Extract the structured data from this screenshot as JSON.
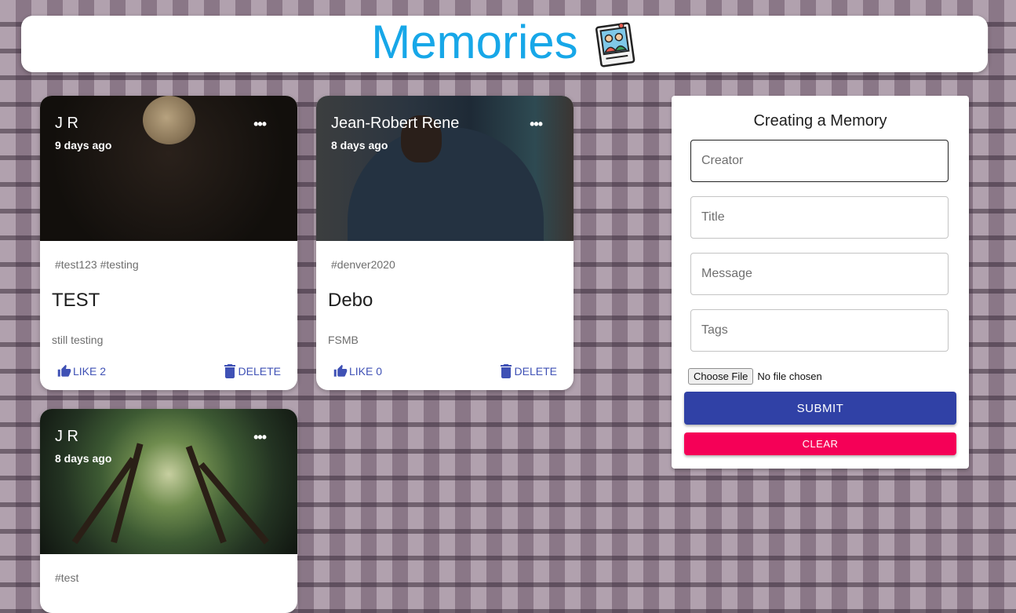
{
  "app_bar": {
    "title": "Memories",
    "logo_icon": "photo-memories-icon"
  },
  "posts": [
    {
      "author": "J R",
      "time": "9 days ago",
      "more_icon": "more-horizontal-icon",
      "tags": "#test123 #testing",
      "title": "TEST",
      "message": "still testing",
      "like_label": "LIKE 2",
      "delete_label": "DELETE"
    },
    {
      "author": "Jean-Robert Rene",
      "time": "8 days ago",
      "more_icon": "more-horizontal-icon",
      "tags": "#denver2020",
      "title": "Debo",
      "message": "FSMB",
      "like_label": "LIKE 0",
      "delete_label": "DELETE"
    },
    {
      "author": "J R",
      "time": "8 days ago",
      "more_icon": "more-horizontal-icon",
      "tags": "#test"
    }
  ],
  "form": {
    "title": "Creating a Memory",
    "creator_placeholder": "Creator",
    "title_placeholder": "Title",
    "message_placeholder": "Message",
    "tags_placeholder": "Tags",
    "file_button": "Choose File",
    "file_status": "No file chosen",
    "submit_label": "SUBMIT",
    "clear_label": "CLEAR"
  },
  "colors": {
    "brand_title": "#17a7e8",
    "primary": "#3041a6",
    "secondary": "#f50057",
    "action_text": "#3f51b5"
  }
}
